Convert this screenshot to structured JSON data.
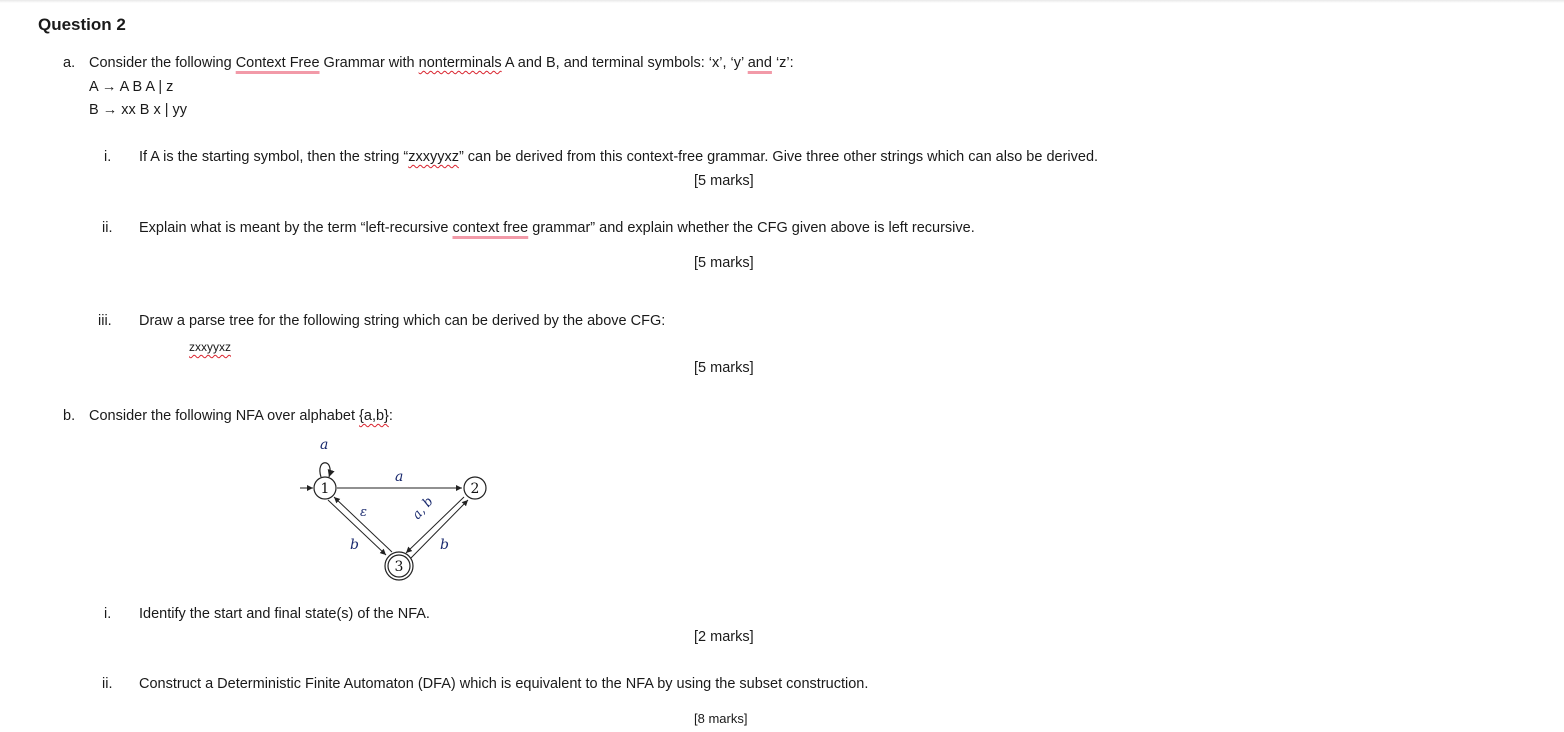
{
  "question": {
    "title": "Question 2",
    "part_a": {
      "label": "a.",
      "intro_parts": [
        "Consider the following ",
        "Context Free",
        " Grammar with ",
        "nonterminals",
        " A and B, and terminal symbols: ‘x’, ‘y’ ",
        "and",
        " ‘z’:"
      ],
      "grammar": [
        "A → A B A | z",
        "B → xx B x | yy"
      ],
      "sub": [
        {
          "label": "i.",
          "text_parts": [
            "If A is the starting symbol, then the string “",
            "zxxyyxz",
            "” can be derived from this context-free grammar. Give three other strings which can also be derived."
          ],
          "marks": "[5 marks]"
        },
        {
          "label": "ii.",
          "text_parts": [
            "Explain what is meant by the term “left-recursive ",
            "context free",
            " grammar” and explain whether the CFG given above is left recursive."
          ],
          "marks": "[5 marks]"
        },
        {
          "label": "iii.",
          "text": "Draw a parse tree for the following string which can be derived by the above CFG:",
          "string": "zxxyyxz",
          "marks": "[5 marks]"
        }
      ]
    },
    "part_b": {
      "label": "b.",
      "intro_parts": [
        "Consider the following NFA over alphabet ",
        "{a,b}",
        ":"
      ],
      "nfa": {
        "states": [
          {
            "id": "1",
            "start": true,
            "final": false
          },
          {
            "id": "2",
            "start": false,
            "final": false
          },
          {
            "id": "3",
            "start": false,
            "final": true
          }
        ],
        "transitions": [
          {
            "from": "1",
            "to": "1",
            "label": "a"
          },
          {
            "from": "1",
            "to": "2",
            "label": "a"
          },
          {
            "from": "3",
            "to": "1",
            "label": "ε"
          },
          {
            "from": "1",
            "to": "3",
            "label": "b"
          },
          {
            "from": "2",
            "to": "3",
            "label": "a, b"
          },
          {
            "from": "3",
            "to": "2",
            "label": "b"
          }
        ]
      },
      "sub": [
        {
          "label": "i.",
          "text": "Identify the start and final state(s) of the NFA.",
          "marks": "[2 marks]"
        },
        {
          "label": "ii.",
          "text": "Construct a Deterministic Finite Automaton (DFA) which is equivalent to the NFA by using the subset construction.",
          "marks": "[8 marks]"
        }
      ]
    }
  }
}
